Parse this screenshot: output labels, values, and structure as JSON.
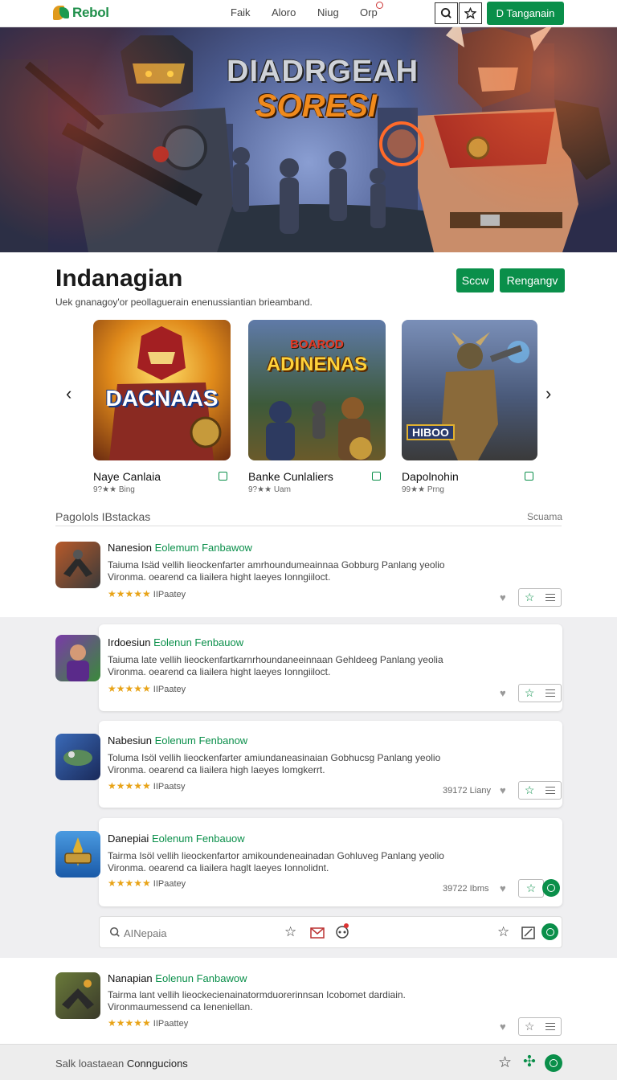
{
  "header": {
    "logo_text": "Rebol",
    "nav": [
      "Faik",
      "Aloro",
      "Niug",
      "Orp"
    ],
    "search_icon": "search-icon",
    "star_icon": "star-icon",
    "cta_label": "D Tanganain"
  },
  "hero": {
    "title_line1": "DIADRGEAH",
    "title_line2": "SORESI"
  },
  "section": {
    "title": "Indanagian",
    "subtitle": "Uek gnanagoy'or peollaguerain enenussiantian brieamband.",
    "btn_small": "Sccw",
    "btn_large": "Rengangv"
  },
  "featured": [
    {
      "art_title": "DACNAAS",
      "name": "Naye Canlaia",
      "meta": "9?★★ Bing"
    },
    {
      "art_title": "ADINENAS",
      "art_sub": "BOAROD",
      "name": "Banke Cunlaliers",
      "meta": "9?★★ Uam"
    },
    {
      "art_title": "HIBOO",
      "name": "Dapolnohin",
      "meta": "99★★ Prng"
    }
  ],
  "list": {
    "heading": "Pagolols IBstackas",
    "heading_right": "Scuama",
    "rows": [
      {
        "title": "Nanesion",
        "title_hl": "Eolemum Fanbawow",
        "desc1": "Taiuma Isäd vellih lieockenfarter amrhoundumeainnaa Gobburg Panlang yeolio",
        "desc2": "Vironma. oearend ca liailera hight laeyes Ionngiiloct.",
        "stars": "★★★★★",
        "rating_meta": "IIPaatey",
        "stat": ""
      },
      {
        "title": "Irdoesiun",
        "title_hl": "Eolenun Fenbauow",
        "desc1": "Taiuma late vellih lieockenfartkarnrhoundaneeinnaan Gehldeeg Panlang yeolia",
        "desc2": "Vironma. oearend ca liailera hight laeyes Ionngiiloct.",
        "stars": "★★★★★",
        "rating_meta": "IIPaatey",
        "stat": ""
      },
      {
        "title": "Nabesiun",
        "title_hl": "Eolenum Fenbanow",
        "desc1": "Toluma Isöl vellih lieockenfarter amiundaneasinaian Gobhucsg Panlang yeolio",
        "desc2": "Vironma. oearend ca liailera high laeyes Iomgkerrt.",
        "stars": "★★★★★",
        "rating_meta": "IIPaatsy",
        "stat": "39172 Liany"
      },
      {
        "title": "Danepiai",
        "title_hl": "Eolenum Fenbauow",
        "desc1": "Tairma Isöl vellih lieockenfartor amikoundeneainadan Gohluveg Panlang yeolio",
        "desc2": "Vironma. oearend ca liailera haglt laeyes Ionnolidnt.",
        "stars": "★★★★★",
        "rating_meta": "IIPaatey",
        "stat": "39722 Ibms"
      },
      {
        "title": "Nanapian",
        "title_hl": "Eolenun Fanbawow",
        "desc1": "Tairma lant vellih lieockecienainatormduorerinnsan Icobomet dardiain.",
        "desc2": "Vironmaumessend ca Ieneniellan.",
        "stars": "★★★★★",
        "rating_meta": "IIPaattey",
        "stat": ""
      }
    ]
  },
  "search_strip": {
    "placeholder": "AINepaia"
  },
  "footer": {
    "text_gray": "Salk loastaean",
    "text_dark": "Conngucions"
  },
  "colors": {
    "brand_green": "#0a8f4a",
    "star_gold": "#e8a317",
    "logo_orange": "#e09a1c"
  }
}
